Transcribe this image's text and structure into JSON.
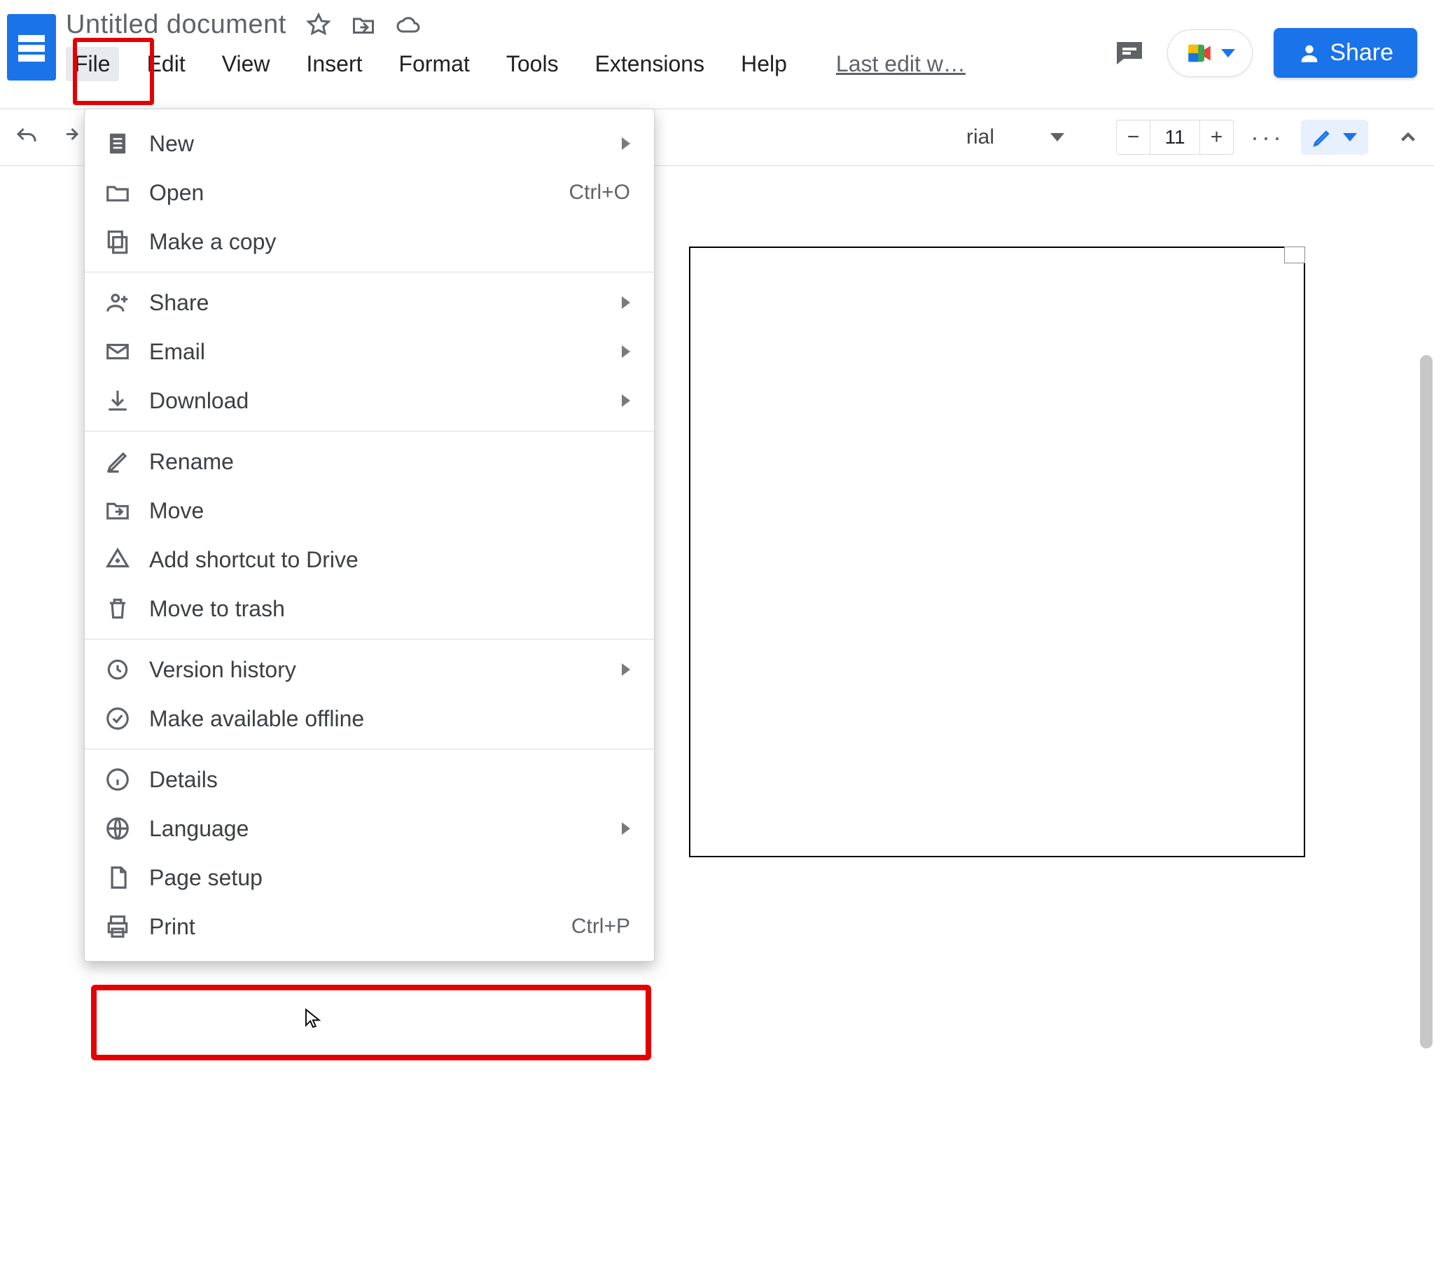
{
  "header": {
    "doc_title": "Untitled document",
    "last_edit": "Last edit w…"
  },
  "menubar": {
    "file": "File",
    "edit": "Edit",
    "view": "View",
    "insert": "Insert",
    "format": "Format",
    "tools": "Tools",
    "extensions": "Extensions",
    "help": "Help"
  },
  "share_button": "Share",
  "toolbar": {
    "font_name_suffix": "rial",
    "font_size": "11"
  },
  "file_menu": {
    "new": "New",
    "open": "Open",
    "open_shortcut": "Ctrl+O",
    "make_copy": "Make a copy",
    "share": "Share",
    "email": "Email",
    "download": "Download",
    "rename": "Rename",
    "move": "Move",
    "add_shortcut": "Add shortcut to Drive",
    "move_trash": "Move to trash",
    "version_history": "Version history",
    "offline": "Make available offline",
    "details": "Details",
    "language": "Language",
    "page_setup": "Page setup",
    "print": "Print",
    "print_shortcut": "Ctrl+P"
  }
}
